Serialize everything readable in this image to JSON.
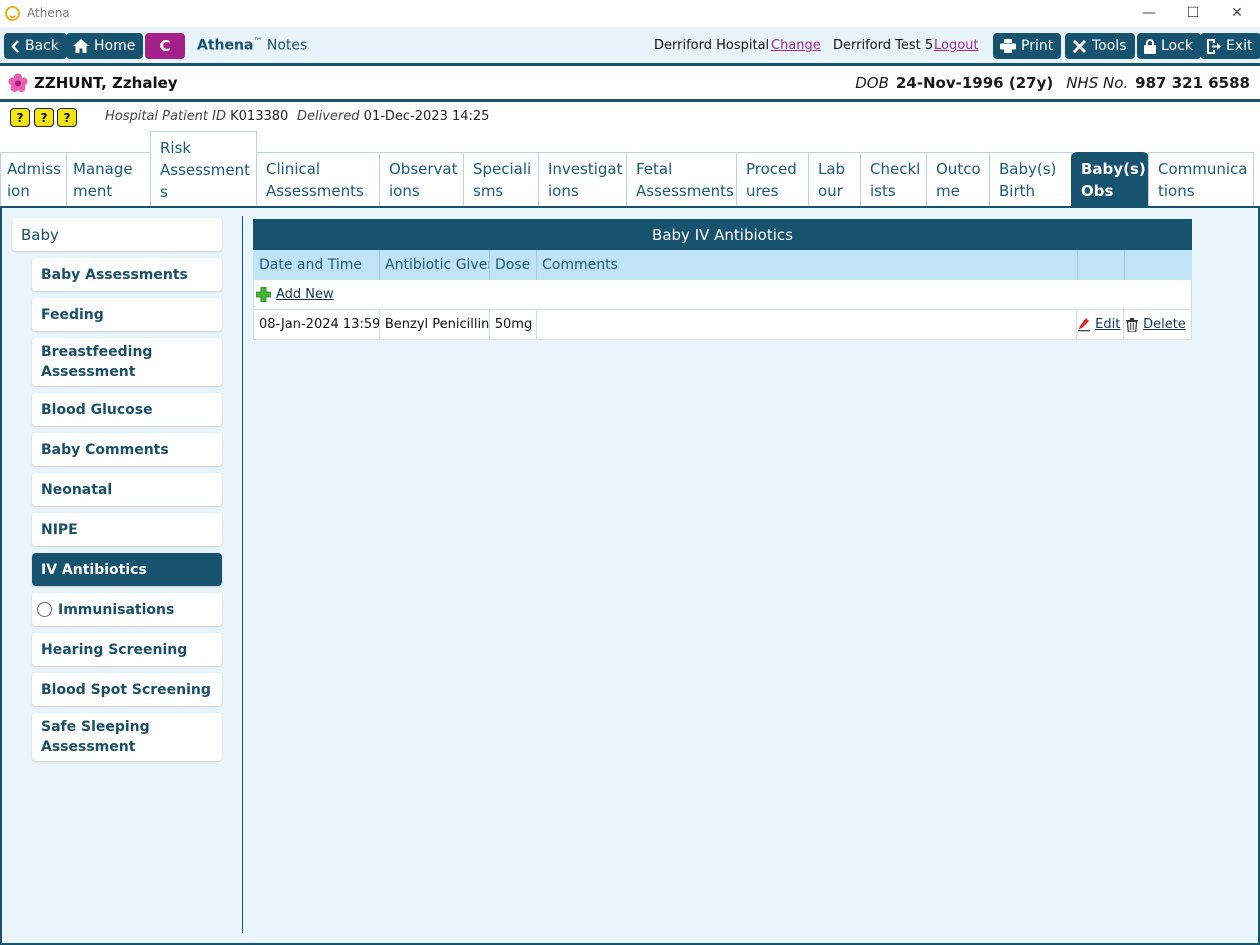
{
  "window": {
    "title": "Athena",
    "controls": {
      "minimize": "—",
      "maximize": "☐",
      "close": "✕"
    }
  },
  "toolbar": {
    "back": "Back",
    "home": "Home",
    "c_button": "C",
    "brand_name": "Athena",
    "brand_tm": "™",
    "brand_suffix": " Notes",
    "hospital": "Derriford Hospital",
    "change": "Change",
    "user": "Derriford Test 5",
    "logout": "Logout",
    "print": "Print",
    "tools": "Tools",
    "lock": "Lock",
    "exit": "Exit"
  },
  "patient": {
    "name": "ZZHUNT, Zzhaley",
    "dob_label": "DOB",
    "dob": "24-Nov-1996 (27y)",
    "nhs_label": "NHS No.",
    "nhs": "987 321 6588"
  },
  "info": {
    "alerts": [
      "?",
      "?",
      "?"
    ],
    "hospital_id_label": "Hospital Patient ID",
    "hospital_id": "K013380",
    "delivered_label": "Delivered",
    "delivered": "01-Dec-2023 14:25"
  },
  "tabs": [
    {
      "key": "admission",
      "l1": "Admiss",
      "l2": "ion"
    },
    {
      "key": "management",
      "l1": "Manage",
      "l2": "ment"
    },
    {
      "key": "risk",
      "l1": "Risk",
      "l2": "Assessment",
      "l3": "s"
    },
    {
      "key": "clinical",
      "l1": "Clinical",
      "l2": "Assessments"
    },
    {
      "key": "observations",
      "l1": "Observat",
      "l2": "ions"
    },
    {
      "key": "specialisms",
      "l1": "Speciali",
      "l2": "sms"
    },
    {
      "key": "investigations",
      "l1": "Investigat",
      "l2": "ions"
    },
    {
      "key": "fetal",
      "l1": "Fetal",
      "l2": "Assessments"
    },
    {
      "key": "procedures",
      "l1": "Proced",
      "l2": "ures"
    },
    {
      "key": "labour",
      "l1": "Lab",
      "l2": "our"
    },
    {
      "key": "checklists",
      "l1": "Checkl",
      "l2": "ists"
    },
    {
      "key": "outcome",
      "l1": "Outco",
      "l2": "me"
    },
    {
      "key": "babys-birth",
      "l1": "Baby(s)",
      "l2": "Birth"
    },
    {
      "key": "babys-obs",
      "l1": "Baby(s)",
      "l2": "Obs"
    },
    {
      "key": "communications",
      "l1": "Communica",
      "l2": "tions"
    }
  ],
  "sidebar": {
    "root": "Baby",
    "items": [
      "Baby Assessments",
      "Feeding",
      "Breastfeeding Assessment",
      "Blood Glucose",
      "Baby Comments",
      "Neonatal",
      "NIPE",
      "IV Antibiotics",
      "Immunisations",
      "Hearing Screening",
      "Blood Spot Screening",
      "Safe Sleeping Assessment"
    ]
  },
  "grid": {
    "title": "Baby IV Antibiotics",
    "columns": [
      "Date and Time",
      "Antibiotic Given",
      "Dose",
      "Comments",
      "",
      ""
    ],
    "add_new": "Add New",
    "rows": [
      {
        "date": "08-Jan-2024 13:59",
        "antibiotic": "Benzyl Penicillin",
        "dose": "50mg",
        "comments": "",
        "edit": "Edit",
        "delete": "Delete"
      }
    ]
  },
  "colors": {
    "primary": "#17526f",
    "accent_purple": "#a51f8a",
    "link_purple": "#a12b9b",
    "content_bg": "#eaf5fb",
    "grid_header_bg": "#c1e3f7",
    "alert_yellow": "#f4e619"
  },
  "icons": {
    "app": "athena-logo-icon",
    "back": "chevron-left-icon",
    "home": "home-icon",
    "print": "printer-icon",
    "tools": "tools-icon",
    "lock": "lock-icon",
    "exit": "exit-icon",
    "patient": "flower-icon",
    "add": "plus-icon",
    "edit": "pencil-icon",
    "delete": "trash-icon"
  }
}
